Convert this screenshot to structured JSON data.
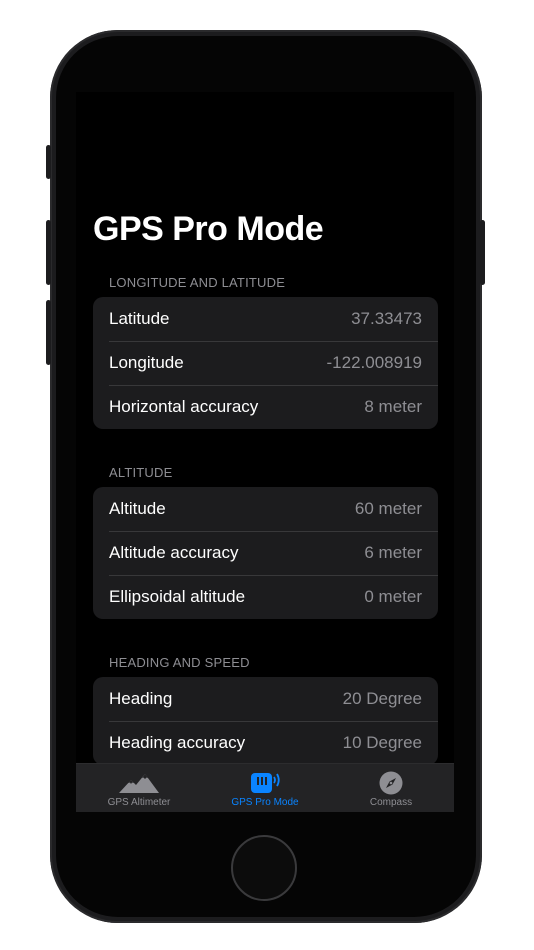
{
  "page": {
    "title": "GPS Pro Mode"
  },
  "sections": [
    {
      "header": "LONGITUDE AND LATITUDE",
      "rows": [
        {
          "label": "Latitude",
          "value": "37.33473"
        },
        {
          "label": "Longitude",
          "value": "-122.008919"
        },
        {
          "label": "Horizontal accuracy",
          "value": "8 meter"
        }
      ]
    },
    {
      "header": "ALTITUDE",
      "rows": [
        {
          "label": "Altitude",
          "value": "60 meter"
        },
        {
          "label": "Altitude accuracy",
          "value": "6 meter"
        },
        {
          "label": "Ellipsoidal altitude",
          "value": "0 meter"
        }
      ]
    },
    {
      "header": "HEADING AND SPEED",
      "rows": [
        {
          "label": "Heading",
          "value": "20 Degree"
        },
        {
          "label": "Heading accuracy",
          "value": "10 Degree"
        }
      ]
    }
  ],
  "tabbar": {
    "tabs": [
      {
        "label": "GPS Altimeter",
        "icon": "mountains-icon",
        "selected": false
      },
      {
        "label": "GPS Pro Mode",
        "icon": "gps-signal-icon",
        "selected": true
      },
      {
        "label": "Compass",
        "icon": "compass-icon",
        "selected": false
      }
    ]
  },
  "colors": {
    "accent": "#0a84ff",
    "background": "#000000",
    "cell": "#1c1c1e",
    "secondary_text": "#8e8e93"
  }
}
